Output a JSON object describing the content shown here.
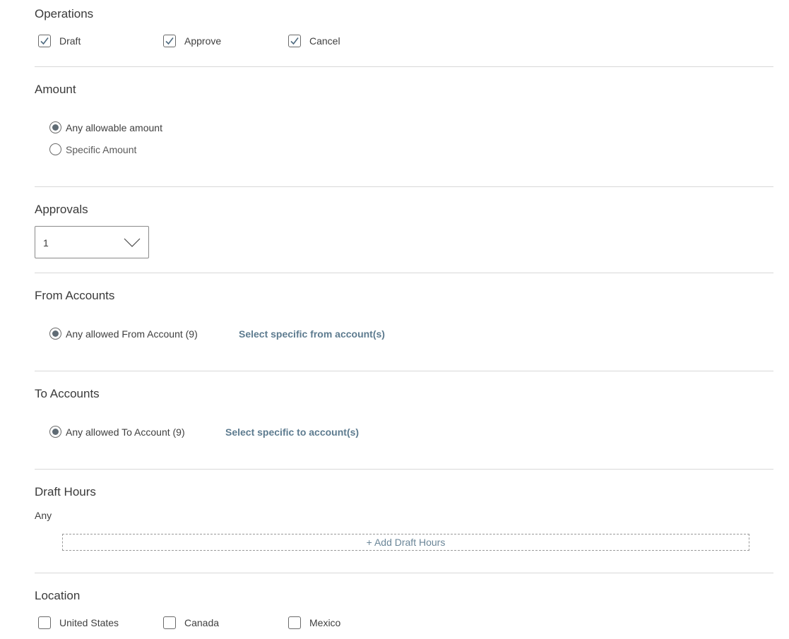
{
  "operations": {
    "title": "Operations",
    "options": [
      {
        "label": "Draft",
        "checked": true
      },
      {
        "label": "Approve",
        "checked": true
      },
      {
        "label": "Cancel",
        "checked": true
      }
    ]
  },
  "amount": {
    "title": "Amount",
    "options": [
      {
        "label": "Any allowable amount",
        "selected": true
      },
      {
        "label": "Specific Amount",
        "selected": false
      }
    ]
  },
  "approvals": {
    "title": "Approvals",
    "selected_value": "1"
  },
  "from_accounts": {
    "title": "From Accounts",
    "radio_label": "Any allowed From Account (9)",
    "radio_selected": true,
    "link_label": "Select specific from account(s)"
  },
  "to_accounts": {
    "title": "To Accounts",
    "radio_label": "Any allowed To Account (9)",
    "radio_selected": true,
    "link_label": "Select specific to account(s)"
  },
  "draft_hours": {
    "title": "Draft Hours",
    "value": "Any",
    "add_label": "+ Add Draft Hours"
  },
  "location": {
    "title": "Location",
    "options": [
      {
        "label": "United States",
        "checked": false
      },
      {
        "label": "Canada",
        "checked": false
      },
      {
        "label": "Mexico",
        "checked": false
      }
    ]
  }
}
